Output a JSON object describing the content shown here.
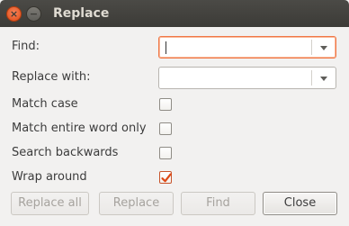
{
  "window": {
    "title": "Replace",
    "close_glyph": "×",
    "minimize_glyph": "−"
  },
  "form": {
    "find_label": "Find:",
    "find_value": "",
    "replace_label": "Replace with:",
    "replace_value": ""
  },
  "options": [
    {
      "label": "Match case",
      "checked": false
    },
    {
      "label": "Match entire word only",
      "checked": false
    },
    {
      "label": "Search backwards",
      "checked": false
    },
    {
      "label": "Wrap around",
      "checked": true
    }
  ],
  "buttons": {
    "replace_all": "Replace all",
    "replace": "Replace",
    "find": "Find",
    "close": "Close"
  },
  "colors": {
    "accent": "#f07746",
    "checkmark": "#df4a16",
    "titlebar": "#3c3b37"
  }
}
